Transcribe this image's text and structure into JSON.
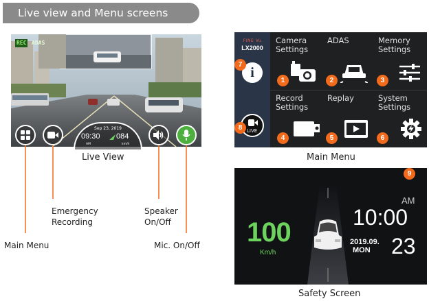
{
  "header": {
    "title": "Live view and Menu screens"
  },
  "live_view": {
    "badge_rec": "REC",
    "badge_adas": "ADAS",
    "date": "Sep 23, 2019",
    "time": "09:30",
    "ampm": "AM",
    "speed": "084",
    "speed_unit": "km/h",
    "caption": "Live View"
  },
  "callouts": {
    "main_menu": "Main Menu",
    "emergency_line1": "Emergency",
    "emergency_line2": "Recording",
    "speaker_line1": "Speaker",
    "speaker_line2": "On/Off",
    "mic": "Mic. On/Off"
  },
  "main_menu": {
    "logo_brand": "FINE Vu",
    "logo_model": "LX2000",
    "live_label": "LIVE",
    "items": [
      {
        "num": "1",
        "line1": "Camera",
        "line2": "Settings"
      },
      {
        "num": "2",
        "line1": "ADAS",
        "line2": ""
      },
      {
        "num": "3",
        "line1": "Memory",
        "line2": "Settings"
      },
      {
        "num": "4",
        "line1": "Record",
        "line2": "Settings"
      },
      {
        "num": "5",
        "line1": "Replay",
        "line2": ""
      },
      {
        "num": "6",
        "line1": "System",
        "line2": "Settings"
      }
    ],
    "info_num": "7",
    "live_num": "8",
    "info_symbol": "i",
    "caption": "Main Menu"
  },
  "safety": {
    "num": "9",
    "speed": "100",
    "unit": "Km/h",
    "ampm": "AM",
    "time": "10:00",
    "date": "2019.09.",
    "weekday": "MON",
    "day": "23",
    "caption": "Safety Screen"
  },
  "colors": {
    "accent": "#f26b1d",
    "green": "#6ed25f",
    "pill": "#8a8a8a",
    "menu_bg": "#1f2021"
  }
}
